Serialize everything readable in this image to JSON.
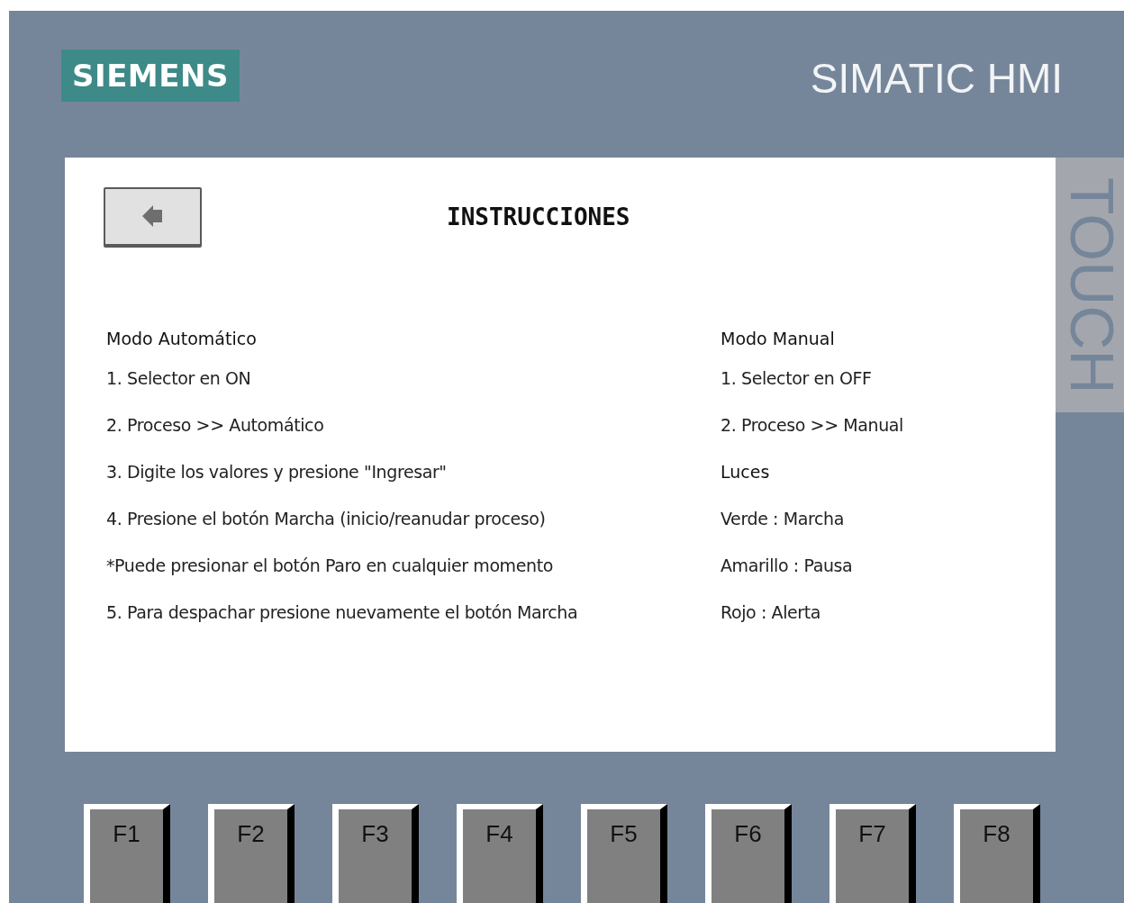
{
  "logo": {
    "text": "SIEMENS"
  },
  "brand": {
    "text": "SIMATIC HMI"
  },
  "screen": {
    "title": "INSTRUCCIONES",
    "columns": [
      {
        "items": [
          {
            "kind": "heading",
            "text": "Modo Automático"
          },
          {
            "kind": "line",
            "text": "1. Selector en ON"
          },
          {
            "kind": "line",
            "text": "2. Proceso >> Automático"
          },
          {
            "kind": "line",
            "text": "3. Digite los valores y presione \"Ingresar\""
          },
          {
            "kind": "line",
            "text": "4. Presione el botón Marcha (inicio/reanudar proceso)"
          },
          {
            "kind": "line",
            "text": "*Puede presionar el botón Paro en cualquier momento"
          },
          {
            "kind": "line",
            "text": "5. Para despachar presione nuevamente el botón Marcha"
          }
        ]
      },
      {
        "items": [
          {
            "kind": "heading",
            "text": "Modo Manual"
          },
          {
            "kind": "line",
            "text": "1. Selector en OFF"
          },
          {
            "kind": "line",
            "text": "2. Proceso >> Manual"
          },
          {
            "kind": "heading",
            "text": "Luces"
          },
          {
            "kind": "line",
            "text": "Verde : Marcha"
          },
          {
            "kind": "line",
            "text": "Amarillo : Pausa"
          },
          {
            "kind": "line",
            "text": "Rojo : Alerta"
          }
        ]
      }
    ]
  },
  "side_label": {
    "text": "TOUCH"
  },
  "function_keys": [
    "F1",
    "F2",
    "F3",
    "F4",
    "F5",
    "F6",
    "F7",
    "F8"
  ]
}
